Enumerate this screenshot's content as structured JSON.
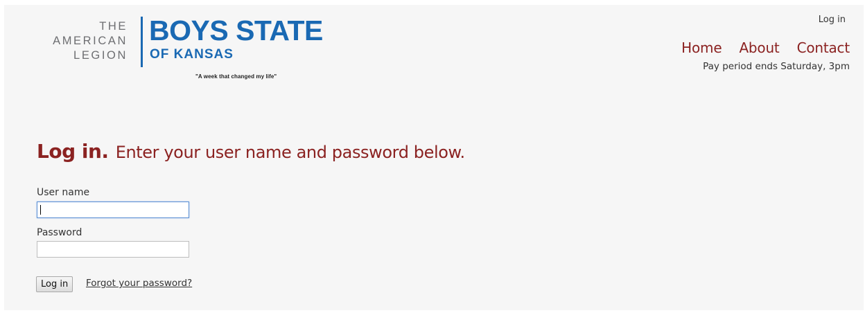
{
  "logo": {
    "legion_lines": [
      "THE",
      "AMERICAN",
      "LEGION"
    ],
    "title": "BOYS STATE",
    "subtitle": "OF KANSAS",
    "tagline": "\"A week that changed my life\""
  },
  "header": {
    "login_link": "Log in",
    "nav": [
      "Home",
      "About",
      "Contact"
    ],
    "notice": "Pay period ends Saturday, 3pm"
  },
  "main": {
    "heading_strong": "Log in.",
    "heading_rest": "Enter your user name and password below.",
    "username_label": "User name",
    "username_value": "",
    "password_label": "Password",
    "password_value": "",
    "submit_label": "Log in",
    "forgot_link": "Forgot your password?"
  },
  "colors": {
    "brand_blue": "#1a69b3",
    "accent_red": "#8b2221",
    "page_bg": "#f6f6f6"
  }
}
